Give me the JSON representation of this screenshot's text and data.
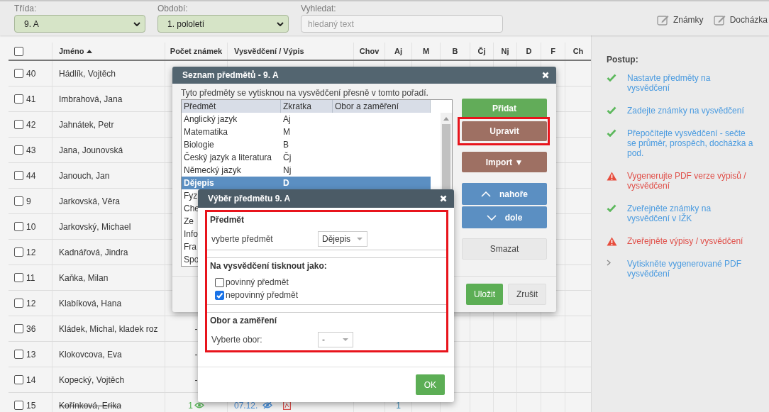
{
  "toolbar": {
    "filters": [
      {
        "label": "Třída:",
        "value": "9. A"
      },
      {
        "label": "Období:",
        "value": "1. pololetí"
      }
    ],
    "search": {
      "label": "Vyhledat:",
      "placeholder": "hledaný text"
    },
    "actions": [
      "Známky",
      "Docházka"
    ]
  },
  "table": {
    "select_all_checked": false,
    "columns": [
      {
        "label": "Jméno",
        "sorted": true
      },
      {
        "label": "Počet známek"
      },
      {
        "label": "Vysvědčení / Výpis"
      },
      {
        "label": "Chov"
      },
      {
        "label": "Aj"
      },
      {
        "label": "M"
      },
      {
        "label": "B"
      },
      {
        "label": "Čj"
      },
      {
        "label": "Nj"
      },
      {
        "label": "D"
      },
      {
        "label": "F"
      },
      {
        "label": "Ch"
      }
    ],
    "rows": [
      {
        "number": "40",
        "name": "Hádlík, Vojtěch",
        "checked": false,
        "struck": false
      },
      {
        "number": "41",
        "name": "Imbrahová, Jana",
        "checked": false,
        "struck": false
      },
      {
        "number": "42",
        "name": "Jahnátek, Petr",
        "checked": false,
        "struck": false
      },
      {
        "number": "43",
        "name": "Jana, Jounovská",
        "checked": false,
        "struck": false
      },
      {
        "number": "44",
        "name": "Janouch, Jan",
        "checked": false,
        "struck": false
      },
      {
        "number": "9",
        "name": "Jarkovská, Věra",
        "checked": false,
        "struck": false
      },
      {
        "number": "10",
        "name": "Jarkovský, Michael",
        "checked": false,
        "struck": false
      },
      {
        "number": "12",
        "name": "Kadnářová, Jindra",
        "checked": false,
        "struck": false
      },
      {
        "number": "11",
        "name": "Kaňka, Milan",
        "checked": false,
        "struck": false
      },
      {
        "number": "12",
        "name": "Klabíková, Hana",
        "checked": false,
        "struck": false
      },
      {
        "number": "36",
        "name": "Kládek, Michal, kladek roz",
        "checked": false,
        "struck": false,
        "count": "-"
      },
      {
        "number": "13",
        "name": "Klokovcova, Eva",
        "checked": false,
        "struck": false,
        "count": "-"
      },
      {
        "number": "14",
        "name": "Kopecký, Vojtěch",
        "checked": false,
        "struck": false,
        "count": "-"
      },
      {
        "number": "15",
        "name": "Kořínková, Erika",
        "checked": false,
        "struck": true,
        "count": "1",
        "report": "07.12.",
        "pdf": true,
        "grades": {
          "aj": "1"
        }
      }
    ]
  },
  "subjects_dialog": {
    "title": "Seznam předmětů - 9. A",
    "description": "Tyto předměty se vytisknou na vysvědčení přesně v tomto pořadí.",
    "columns": [
      "Předmět",
      "Zkratka",
      "Obor a zaměření"
    ],
    "rows": [
      {
        "subject": "Anglický jazyk",
        "abbr": "Aj",
        "selected": false
      },
      {
        "subject": "Matematika",
        "abbr": "M",
        "selected": false
      },
      {
        "subject": "Biologie",
        "abbr": "B",
        "selected": false
      },
      {
        "subject": "Český jazyk a literatura",
        "abbr": "Čj",
        "selected": false
      },
      {
        "subject": "Německý jazyk",
        "abbr": "Nj",
        "selected": false
      },
      {
        "subject": "Dějepis",
        "abbr": "D",
        "selected": true
      },
      {
        "subject": "Fyz",
        "selected": false
      },
      {
        "subject": "Che",
        "selected": false
      },
      {
        "subject": "Ze",
        "selected": false
      },
      {
        "subject": "Info",
        "selected": false
      },
      {
        "subject": "Fra",
        "selected": false
      },
      {
        "subject": "Spo",
        "selected": false
      }
    ],
    "buttons": [
      {
        "label": "Přidat",
        "kind": "add",
        "highlighted": false
      },
      {
        "label": "Upravit",
        "kind": "edit",
        "highlighted": true
      },
      {
        "label": "Import ▼",
        "kind": "import",
        "highlighted": false
      },
      {
        "label": "nahoře",
        "kind": "up",
        "highlighted": false
      },
      {
        "label": "dole",
        "kind": "down",
        "highlighted": false
      },
      {
        "label": "Smazat",
        "kind": "delete",
        "highlighted": false
      }
    ],
    "footer_buttons": [
      {
        "label": "Uložit",
        "kind": "primary"
      },
      {
        "label": "Zrušit",
        "kind": "secondary"
      }
    ]
  },
  "subject_dialog": {
    "title": "Výběr předmětu 9. A",
    "highlighted": true,
    "sections": [
      {
        "kind": "select",
        "heading": "Předmět",
        "label": "vyberte předmět",
        "value": "Dějepis"
      },
      {
        "kind": "checkboxes",
        "heading": "Na vysvědčení tisknout jako:",
        "options": [
          {
            "label": "povinný předmět",
            "checked": false
          },
          {
            "label": "nepovinný předmět",
            "checked": true
          }
        ]
      },
      {
        "kind": "select",
        "heading": "Obor a zaměření",
        "label": "Vyberte obor:",
        "value": "-"
      }
    ],
    "ok": "OK"
  },
  "sidebar": {
    "title": "Postup:",
    "steps": [
      {
        "text": "Nastavte předměty na vysvědčení",
        "kind": "done"
      },
      {
        "text": "Zadejte známky na vysvědčení",
        "kind": "done"
      },
      {
        "text": "Přepočítejte vysvědčení - sečte se průměr, prospěch, docházka a pod.",
        "kind": "done"
      },
      {
        "text": "Vygenerujte PDF verze výpisů / vysvědčení",
        "kind": "warning"
      },
      {
        "text": "Zveřejněte známky na vysvědčení v IŽK",
        "kind": "done"
      },
      {
        "text": "Zveřejněte výpisy / vysvědčení",
        "kind": "warning"
      },
      {
        "text": "Vytiskněte vygenerované PDF vysvědčení",
        "kind": "pending"
      }
    ]
  }
}
